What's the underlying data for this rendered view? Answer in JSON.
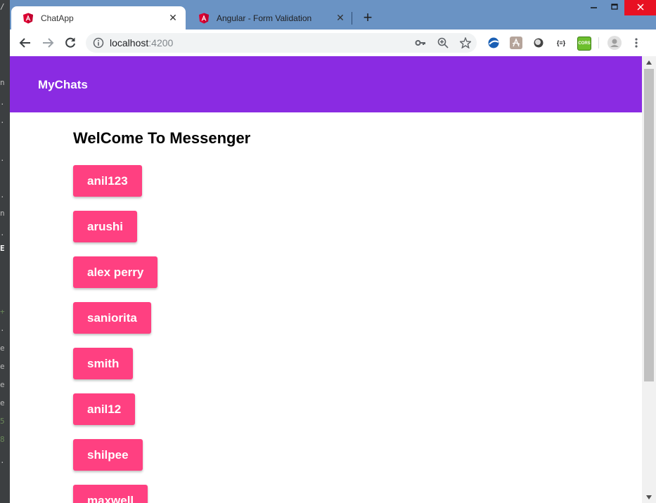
{
  "browser": {
    "tabs": [
      {
        "title": "ChatApp",
        "active": true,
        "favicon": "angular-icon"
      },
      {
        "title": "Angular - Form Validation",
        "active": false,
        "favicon": "angular-icon"
      }
    ],
    "url_host": "localhost",
    "url_port": ":4200",
    "extensions": [
      "extension-globe-icon",
      "extension-pdf-icon",
      "extension-circle-icon",
      "extension-json-icon",
      "extension-cors-icon"
    ],
    "json_ext_label": "{≡}",
    "cors_ext_label": "CORS"
  },
  "app": {
    "brand": "MyChats",
    "welcome": "WelCome To Messenger",
    "users": [
      "anil123",
      "arushi",
      "alex perry",
      "saniorita",
      "smith",
      "anil12",
      "shilpee",
      "maxwell"
    ]
  },
  "colors": {
    "header": "#8a2be2",
    "user_button": "#ff4081",
    "titlebar": "#6a93c4",
    "close": "#e81123"
  }
}
